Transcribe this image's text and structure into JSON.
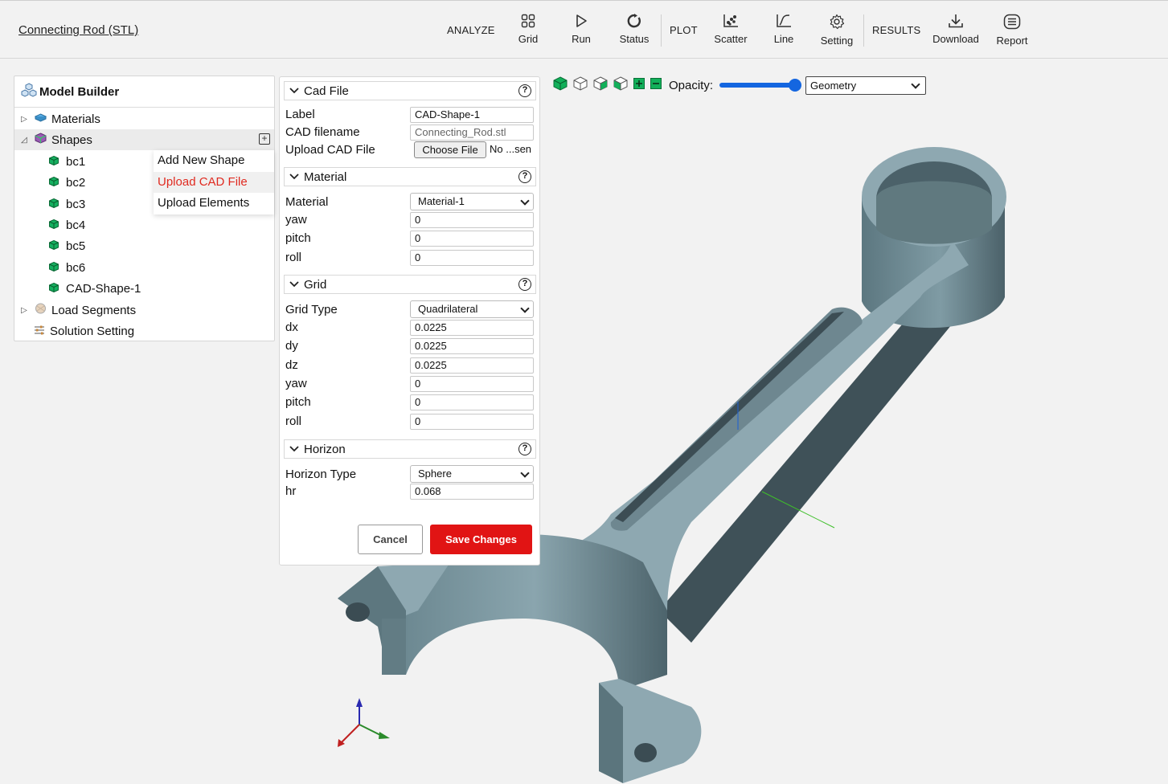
{
  "app": {
    "title": "Connecting Rod (STL)"
  },
  "toolbar": {
    "analyze_label": "ANALYZE",
    "plot_label": "PLOT",
    "results_label": "RESULTS",
    "grid": "Grid",
    "run": "Run",
    "status": "Status",
    "scatter": "Scatter",
    "line": "Line",
    "setting": "Setting",
    "download": "Download",
    "report": "Report"
  },
  "model_builder": {
    "title": "Model Builder",
    "materials": "Materials",
    "shapes": "Shapes",
    "shape_items": [
      "bc1",
      "bc2",
      "bc3",
      "bc4",
      "bc5",
      "bc6",
      "CAD-Shape-1"
    ],
    "load_segments": "Load Segments",
    "solution_setting": "Solution Setting"
  },
  "context_menu": {
    "items": [
      "Add New Shape",
      "Upload CAD File",
      "Upload Elements"
    ]
  },
  "cad_file": {
    "header": "Cad File",
    "label_label": "Label",
    "label_value": "CAD-Shape-1",
    "filename_label": "CAD filename",
    "filename_value": "Connecting_Rod.stl",
    "upload_label": "Upload CAD File",
    "choose_button": "Choose File",
    "no_file_text": "No ...sen"
  },
  "material": {
    "header": "Material",
    "material_label": "Material",
    "material_value": "Material-1",
    "yaw_label": "yaw",
    "yaw_value": "0",
    "pitch_label": "pitch",
    "pitch_value": "0",
    "roll_label": "roll",
    "roll_value": "0"
  },
  "grid": {
    "header": "Grid",
    "type_label": "Grid Type",
    "type_value": "Quadrilateral",
    "dx_label": "dx",
    "dx_value": "0.0225",
    "dy_label": "dy",
    "dy_value": "0.0225",
    "dz_label": "dz",
    "dz_value": "0.0225",
    "yaw_label": "yaw",
    "yaw_value": "0",
    "pitch_label": "pitch",
    "pitch_value": "0",
    "roll_label": "roll",
    "roll_value": "0"
  },
  "horizon": {
    "header": "Horizon",
    "type_label": "Horizon Type",
    "type_value": "Sphere",
    "hr_label": "hr",
    "hr_value": "0.068"
  },
  "actions": {
    "cancel": "Cancel",
    "save": "Save Changes"
  },
  "viewer": {
    "opacity_label": "Opacity:",
    "opacity_value": 1.0,
    "view_mode": "Geometry",
    "model_color": "#8ea8b1",
    "accent": "#e11414",
    "slider_color": "#1466e0"
  }
}
